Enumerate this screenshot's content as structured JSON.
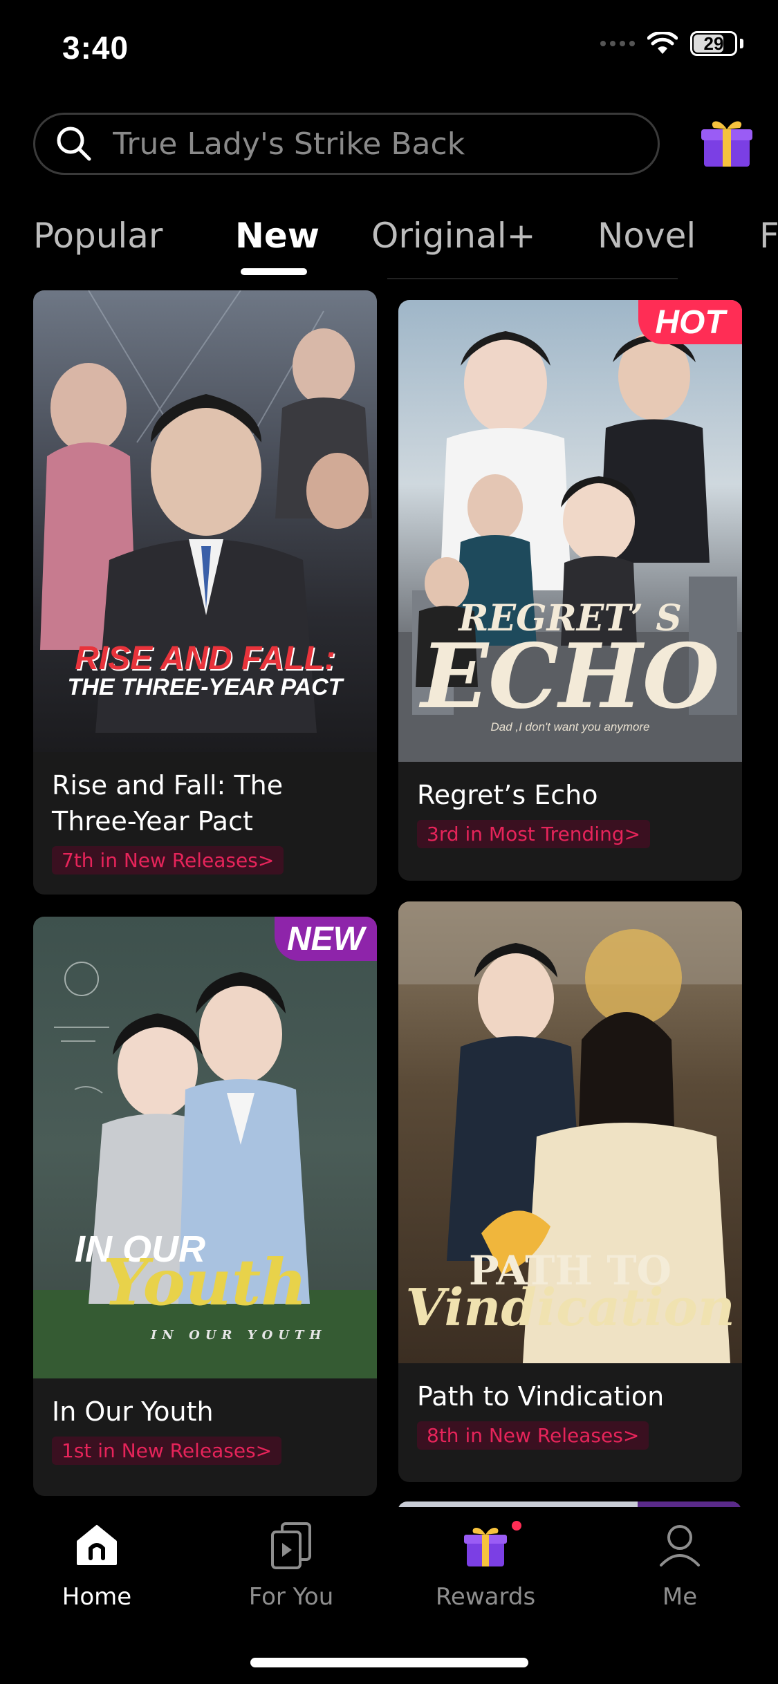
{
  "status": {
    "time": "3:40",
    "battery": "29",
    "battery_level": 0.29
  },
  "search": {
    "placeholder": "True Lady's Strike Back"
  },
  "tabs": [
    {
      "label": "Popular",
      "active": false
    },
    {
      "label": "New",
      "active": true
    },
    {
      "label": "Original+",
      "active": false
    },
    {
      "label": "Novel",
      "active": false
    },
    {
      "label": "F",
      "active": false
    }
  ],
  "cards": [
    {
      "title": "Rise and Fall: The Three-Year Pact",
      "rank": "7th in New Releases>",
      "poster_line1": "RISE AND FALL:",
      "poster_line2": "THE THREE-YEAR PACT"
    },
    {
      "title": "Regret’s Echo",
      "rank": "3rd in Most Trending>",
      "badge": "HOT",
      "poster_line1": "REGRET’ S",
      "poster_line2": "ECHO",
      "poster_tagline": "Dad ,I don't want you anymore"
    },
    {
      "title": "In Our Youth",
      "rank": "1st in New Releases>",
      "badge": "NEW",
      "poster_line1": "IN OUR",
      "poster_line2": "Youth",
      "poster_tagline": "IN OUR YOUTH"
    },
    {
      "title": "Path to Vindication",
      "rank": "8th in New Releases>",
      "poster_line1": "PATH TO",
      "poster_line2": "Vindication"
    }
  ],
  "nav": [
    {
      "label": "Home",
      "icon": "home-icon",
      "active": true
    },
    {
      "label": "For You",
      "icon": "play-cards-icon",
      "active": false
    },
    {
      "label": "Rewards",
      "icon": "gift-icon",
      "active": false
    },
    {
      "label": "Me",
      "icon": "user-icon",
      "active": false
    }
  ],
  "colors": {
    "accent": "#e6245a",
    "hot_badge": "#ff2d55",
    "new_badge": "#8e24aa",
    "card_bg": "#1a1a1a"
  }
}
